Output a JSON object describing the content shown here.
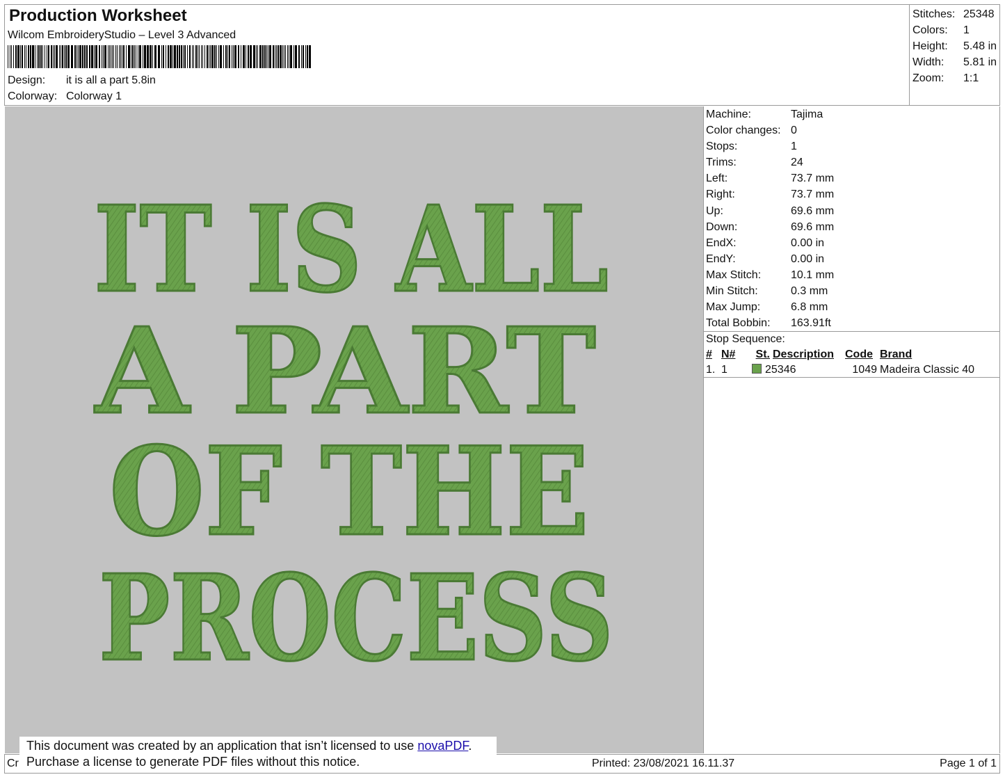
{
  "header": {
    "title": "Production Worksheet",
    "software": "Wilcom EmbroideryStudio – Level 3 Advanced",
    "design_label": "Design:",
    "design_value": "it is all a part 5.8in",
    "colorway_label": "Colorway:",
    "colorway_value": "Colorway 1"
  },
  "stats": [
    {
      "label": "Stitches:",
      "value": "25348"
    },
    {
      "label": "Colors:",
      "value": "1"
    },
    {
      "label": "Height:",
      "value": "5.48 in"
    },
    {
      "label": "Width:",
      "value": "5.81 in"
    },
    {
      "label": "Zoom:",
      "value": "1:1"
    }
  ],
  "design_text": {
    "line1": "IT IS ALL",
    "line2": "A PART",
    "line3": "OF THE",
    "line4": "PROCESS",
    "thread_color": "#6aa24c"
  },
  "machine_info": [
    {
      "label": "Machine:",
      "value": "Tajima"
    },
    {
      "label": "Color changes:",
      "value": "0"
    },
    {
      "label": "Stops:",
      "value": "1"
    },
    {
      "label": "Trims:",
      "value": "24"
    },
    {
      "label": "Left:",
      "value": "73.7 mm"
    },
    {
      "label": "Right:",
      "value": "73.7 mm"
    },
    {
      "label": "Up:",
      "value": "69.6 mm"
    },
    {
      "label": "Down:",
      "value": "69.6 mm"
    },
    {
      "label": "EndX:",
      "value": "0.00 in"
    },
    {
      "label": "EndY:",
      "value": "0.00 in"
    },
    {
      "label": "Max Stitch:",
      "value": "10.1 mm"
    },
    {
      "label": "Min Stitch:",
      "value": "0.3 mm"
    },
    {
      "label": "Max Jump:",
      "value": "6.8 mm"
    },
    {
      "label": "Total Bobbin:",
      "value": "163.91ft"
    }
  ],
  "stop_sequence": {
    "label": "Stop Sequence:",
    "columns": [
      "#",
      "N#",
      "St.",
      "Description",
      "Code",
      "Brand"
    ],
    "rows": [
      {
        "num": "1.",
        "n": "1",
        "stitches": "25346",
        "description": "",
        "code": "1049",
        "brand": "Madeira Classic 40",
        "color": "#6aa24c"
      }
    ]
  },
  "footer": {
    "left": "Cr",
    "printed": "Printed: 23/08/2021 16.11.37",
    "page": "Page 1 of 1"
  },
  "notice": {
    "line1_prefix": "This document was created by an application that isn’t licensed to use ",
    "link": "novaPDF",
    "line1_suffix": ".",
    "line2": "Purchase a license to generate PDF files without this notice."
  }
}
